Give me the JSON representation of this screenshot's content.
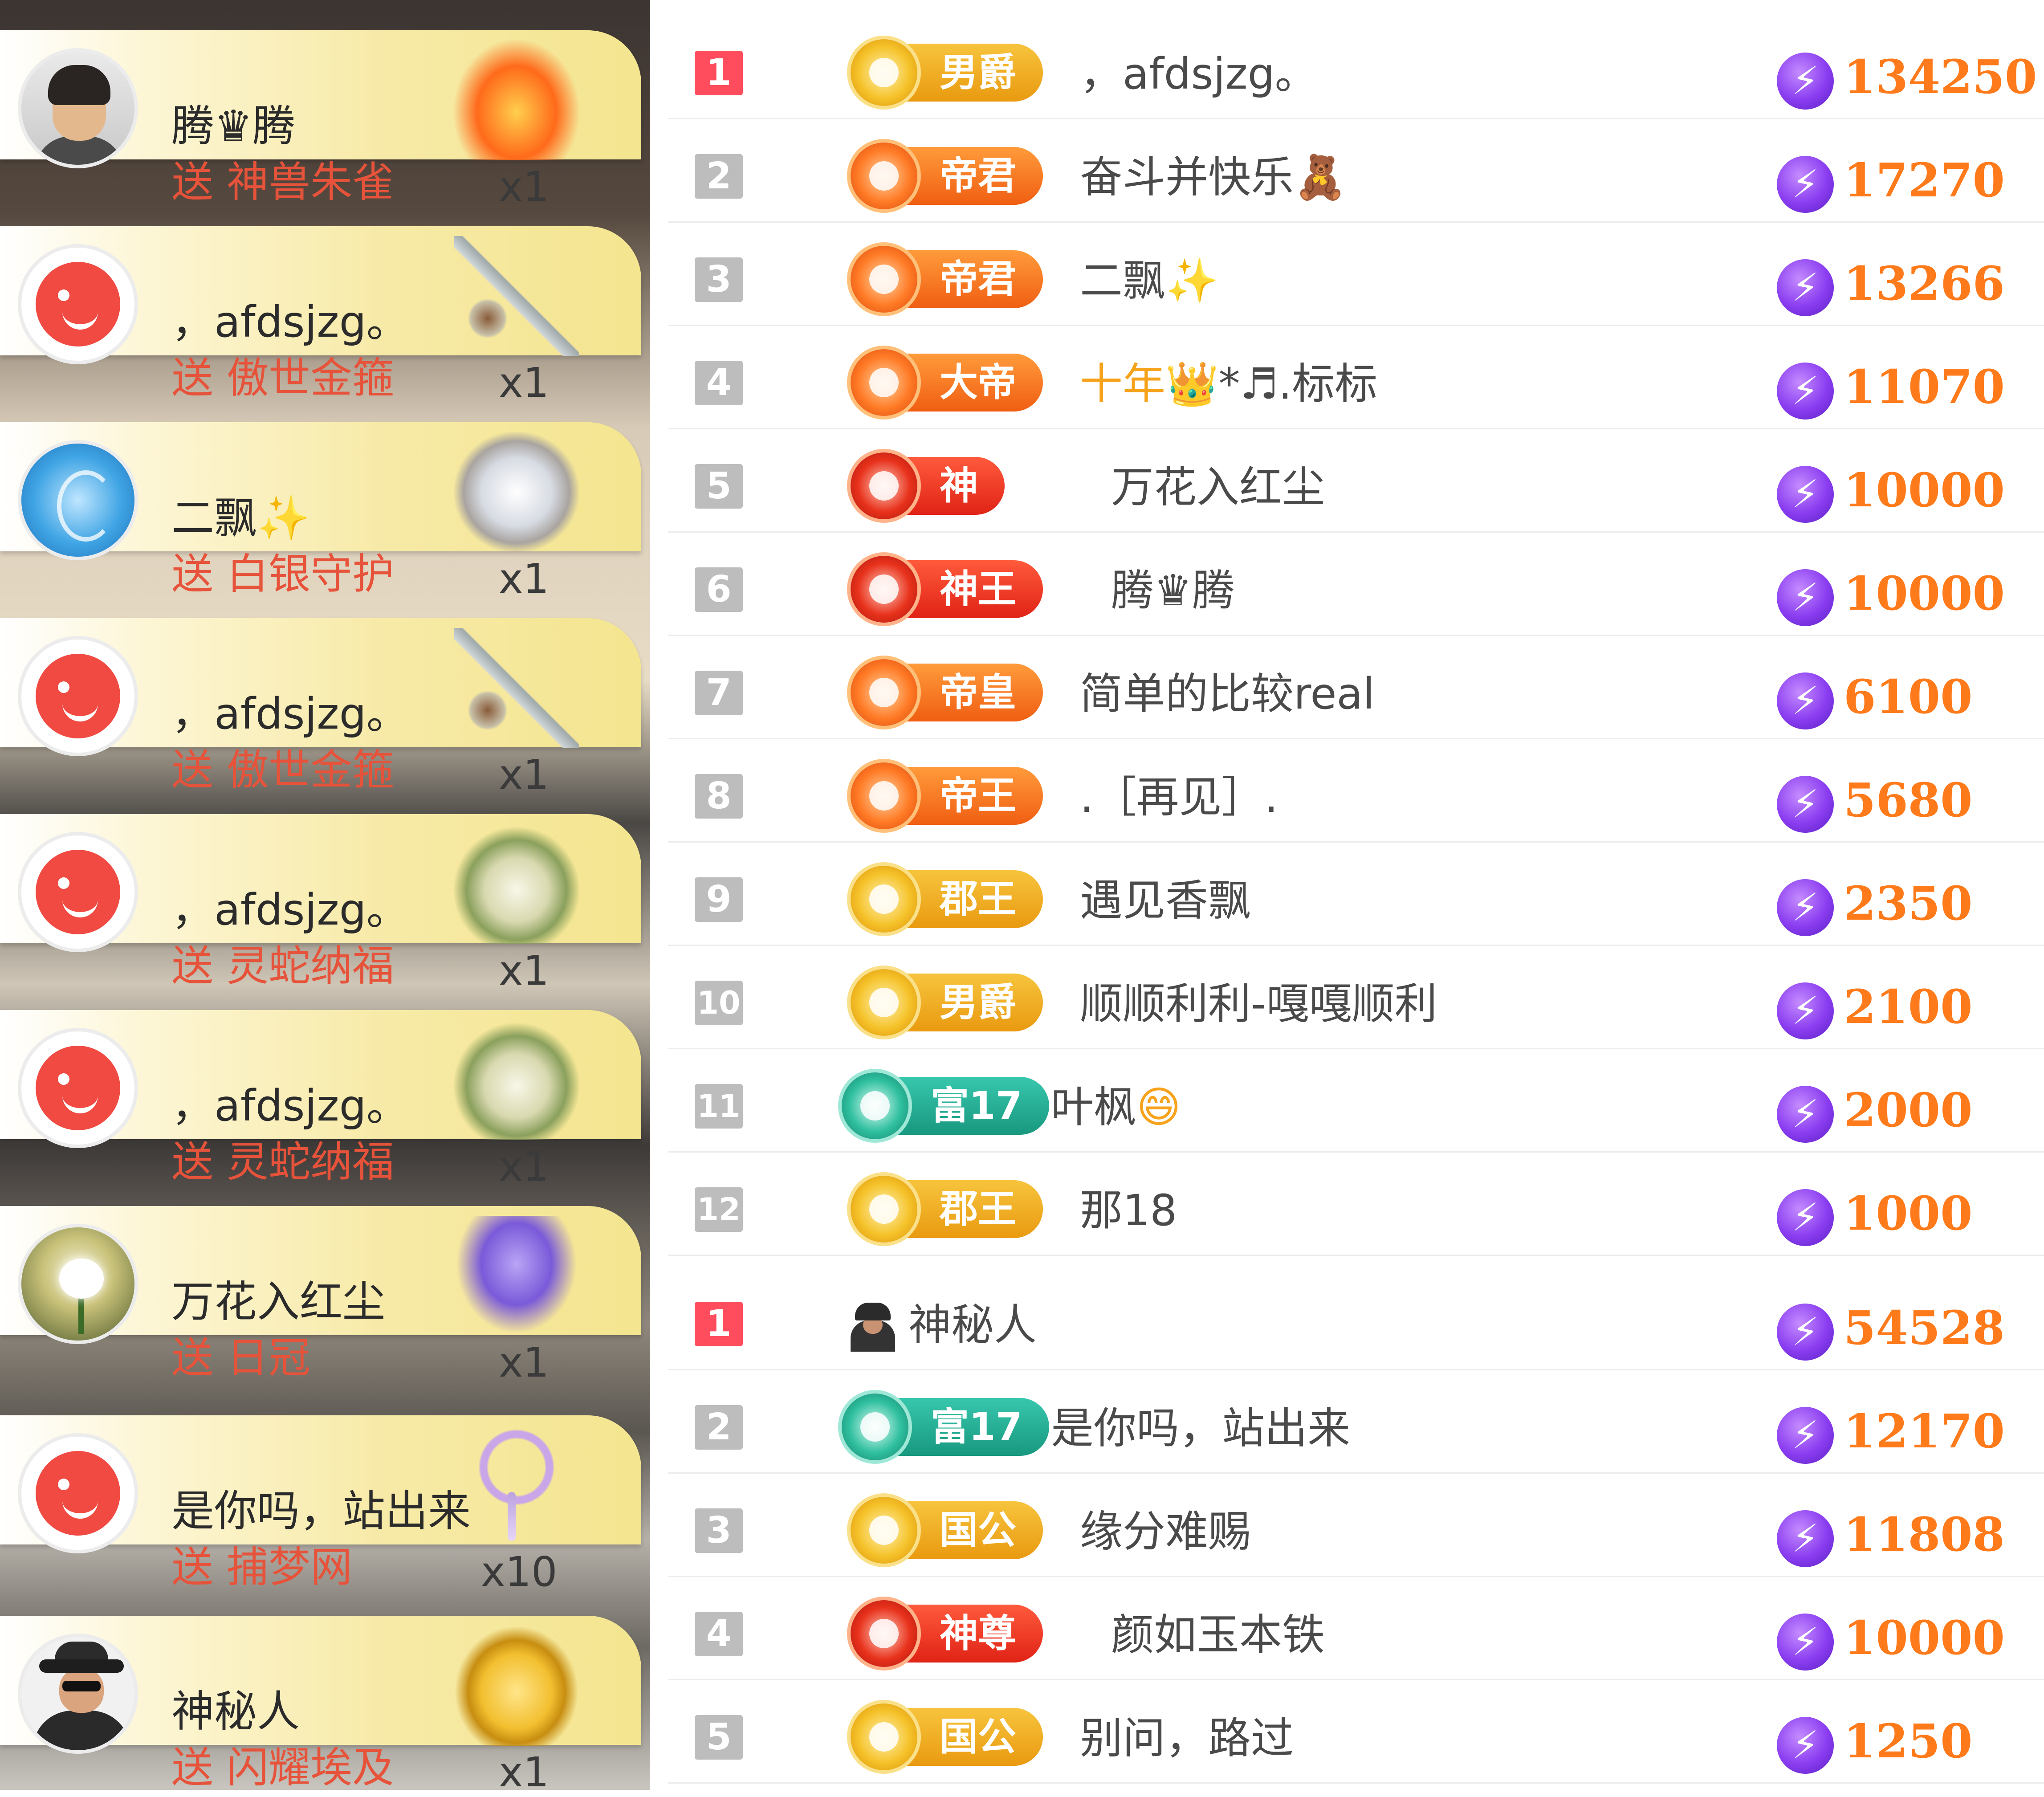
{
  "gift_feed": [
    {
      "sender": "腾♛腾",
      "verb": "送",
      "gift": "神兽朱雀",
      "count": "x1",
      "avatar": "man-avatar",
      "gift_icon": "phoenix-icon"
    },
    {
      "sender": "，afdsjzg。",
      "verb": "送",
      "gift": "傲世金箍",
      "count": "x1",
      "avatar": "red-smiley-avatar",
      "gift_icon": "staff-icon"
    },
    {
      "sender": "二飘✨",
      "verb": "送",
      "gift": "白银守护",
      "count": "x1",
      "avatar": "blue-avatar",
      "gift_icon": "silver-shield-icon"
    },
    {
      "sender": "，afdsjzg。",
      "verb": "送",
      "gift": "傲世金箍",
      "count": "x1",
      "avatar": "red-smiley-avatar",
      "gift_icon": "staff-icon"
    },
    {
      "sender": "，afdsjzg。",
      "verb": "送",
      "gift": "灵蛇纳福",
      "count": "x1",
      "avatar": "red-smiley-avatar",
      "gift_icon": "snake-icon"
    },
    {
      "sender": "，afdsjzg。",
      "verb": "送",
      "gift": "灵蛇纳福",
      "count": "x1",
      "avatar": "red-smiley-avatar",
      "gift_icon": "snake-icon"
    },
    {
      "sender": "万花入红尘",
      "verb": "送",
      "gift": "日冠",
      "count": "x1",
      "avatar": "flower-avatar",
      "gift_icon": "crown-icon"
    },
    {
      "sender": "是你吗，站出来",
      "verb": "送",
      "gift": "捕梦网",
      "count": "x10",
      "avatar": "red-smiley-avatar",
      "gift_icon": "dreamcatcher-icon"
    },
    {
      "sender": "神秘人",
      "verb": "送",
      "gift": "闪耀埃及",
      "count": "x1",
      "avatar": "mystery-avatar",
      "gift_icon": "pyramid-icon"
    }
  ],
  "ranking_top": [
    {
      "rank": "1",
      "badge": "男爵",
      "badge_style": "gold",
      "name": "，afdsjzg。",
      "name_deco": "",
      "score": "134250"
    },
    {
      "rank": "2",
      "badge": "帝君",
      "badge_style": "orange",
      "name": "奋斗并快乐",
      "name_deco": "🧸",
      "score": "17270"
    },
    {
      "rank": "3",
      "badge": "帝君",
      "badge_style": "orange",
      "name": "二飘",
      "name_deco": "✨",
      "score": "13266"
    },
    {
      "rank": "4",
      "badge": "大帝",
      "badge_style": "orange",
      "name": "*♬.标标",
      "name_deco": "十年👑",
      "score": "11070"
    },
    {
      "rank": "5",
      "badge": "神",
      "badge_style": "red",
      "name": "万花入红尘",
      "name_deco": "",
      "score": "10000"
    },
    {
      "rank": "6",
      "badge": "神王",
      "badge_style": "red",
      "name": "腾♛腾",
      "name_deco": "",
      "score": "10000"
    },
    {
      "rank": "7",
      "badge": "帝皇",
      "badge_style": "orange",
      "name": "简单的比较real",
      "name_deco": "",
      "score": "6100"
    },
    {
      "rank": "8",
      "badge": "帝王",
      "badge_style": "orange",
      "name": ".［再见］.",
      "name_deco": "",
      "score": "5680"
    },
    {
      "rank": "9",
      "badge": "郡王",
      "badge_style": "gold",
      "name": "遇见香飘",
      "name_deco": "",
      "score": "2350"
    },
    {
      "rank": "10",
      "badge": "男爵",
      "badge_style": "gold",
      "name": "顺顺利利-嘎嘎顺利",
      "name_deco": "",
      "score": "2100"
    },
    {
      "rank": "11",
      "badge": "富17",
      "badge_style": "teal",
      "name": "叶枫",
      "name_deco": "😄",
      "score": "2000"
    },
    {
      "rank": "12",
      "badge": "郡王",
      "badge_style": "gold",
      "name": "那18",
      "name_deco": "",
      "score": "1000"
    }
  ],
  "ranking_bottom": [
    {
      "rank": "1",
      "badge": "",
      "badge_style": "none",
      "name": "神秘人",
      "name_deco": "",
      "score": "54528",
      "icon": "mystery-person-icon"
    },
    {
      "rank": "2",
      "badge": "富17",
      "badge_style": "teal",
      "name": "是你吗，站出来",
      "name_deco": "",
      "score": "12170"
    },
    {
      "rank": "3",
      "badge": "国公",
      "badge_style": "gold",
      "name": "缘分难赐",
      "name_deco": "",
      "score": "11808"
    },
    {
      "rank": "4",
      "badge": "神尊",
      "badge_style": "red",
      "name": "颜如玉本铁",
      "name_deco": "",
      "score": "10000"
    },
    {
      "rank": "5",
      "badge": "国公",
      "badge_style": "gold",
      "name": "别问，路过",
      "name_deco": "",
      "score": "1250"
    }
  ],
  "colors": {
    "score": "#ff7a1a",
    "first_rank": "#ff4d5e",
    "gift_text": "#e6533a",
    "bolt": "#8a3df0"
  }
}
